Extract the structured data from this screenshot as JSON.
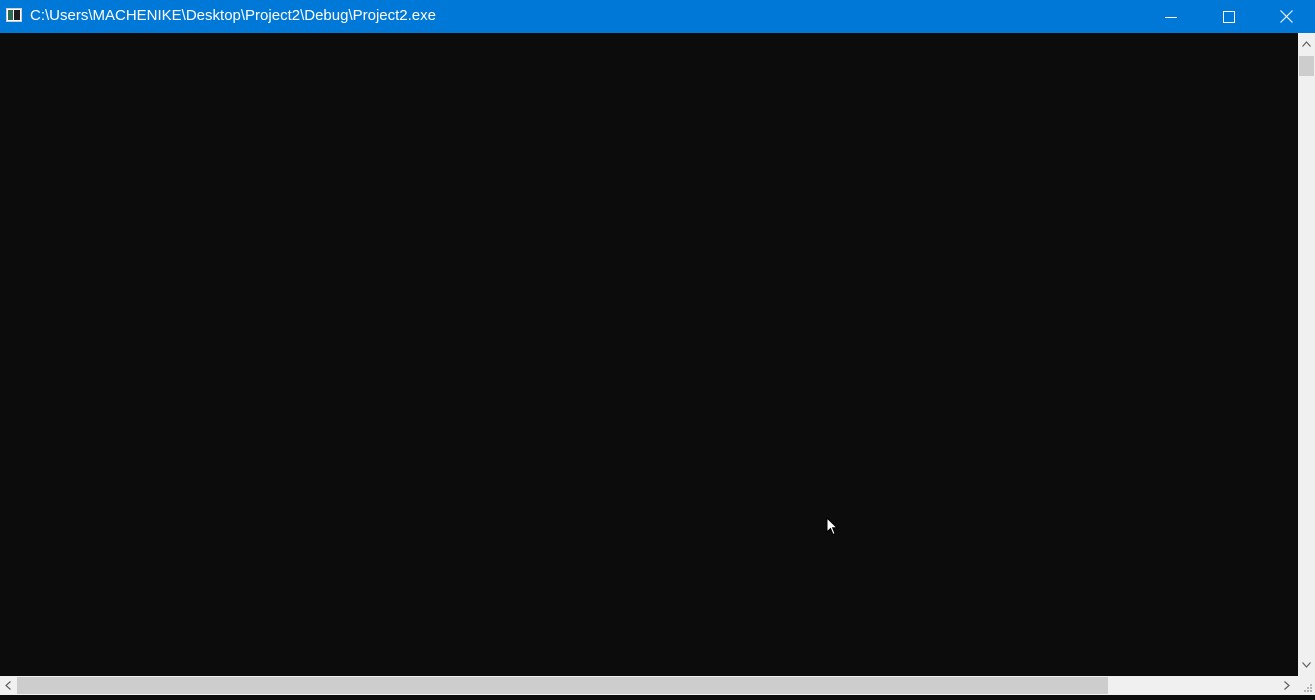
{
  "window": {
    "title": "C:\\Users\\MACHENIKE\\Desktop\\Project2\\Debug\\Project2.exe",
    "accent_color": "#0078d7",
    "console_background": "#0c0c0c",
    "controls": {
      "minimize_icon": "minimize-icon",
      "maximize_icon": "maximize-icon",
      "close_icon": "close-icon"
    }
  },
  "console": {
    "output": ""
  },
  "scrollbars": {
    "vertical": {
      "up_icon": "chevron-up-icon",
      "down_icon": "chevron-down-icon"
    },
    "horizontal": {
      "left_icon": "chevron-left-icon",
      "right_icon": "chevron-right-icon"
    }
  }
}
